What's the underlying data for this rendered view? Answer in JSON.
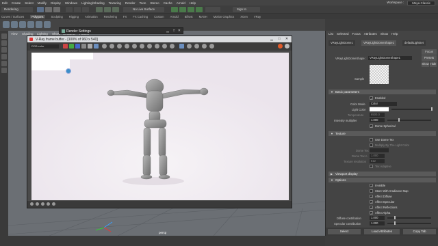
{
  "menubar": {
    "items": [
      "Edit",
      "Create",
      "Select",
      "Modify",
      "Display",
      "Windows",
      "Lighting/Shading",
      "Texturing",
      "Render",
      "Toon",
      "Stereo",
      "Cache",
      "Arnold",
      "Help"
    ],
    "workspace_label": "Workspace :",
    "workspace_value": "Maya Classic"
  },
  "statusline": {
    "mode": "Rendering",
    "symmetry": "No Live Surface",
    "sign_in": "Sign In"
  },
  "shelf": {
    "tabs": [
      "Curves / Surfaces",
      "Polygons",
      "Sculpting",
      "Rigging",
      "Animation",
      "Rendering",
      "FX",
      "FX Caching",
      "Custom",
      "Arnold",
      "Bifrost",
      "MASH",
      "Motion Graphics",
      "XGen",
      "VRay"
    ],
    "active_tab": "Polygons"
  },
  "viewport": {
    "menu": [
      "View",
      "Shading",
      "Lighting",
      "Show",
      "Renderer",
      "Panels"
    ],
    "camera_label": "persp"
  },
  "render_settings_window": {
    "title": "Render Settings"
  },
  "frame_buffer": {
    "title": "V-Ray frame buffer - [100% of 960 x 540]",
    "channel": "RGB color"
  },
  "attribute_editor": {
    "menu": [
      "List",
      "Selected",
      "Focus",
      "Attributes",
      "Show",
      "Help"
    ],
    "node_tabs": [
      "VRayLightDome1",
      "VRayLightDomeShape1",
      "defaultLightSet"
    ],
    "node_type_label": "VRayLightDomeShape:",
    "node_name": "VRayLightDomeShape1",
    "side_buttons": [
      "Focus",
      "Presets",
      "Show",
      "Hide"
    ],
    "sample_label": "Sample",
    "sections": {
      "basic": "Basic parameters",
      "texture": "Texture",
      "viewport": "Viewport display",
      "options": "Options"
    },
    "basic": {
      "enabled": "Enabled",
      "color_mode_label": "Color Mode",
      "color_mode_value": "Color",
      "light_color_label": "Light Color",
      "temperature_label": "Temperature",
      "temperature_value": "6500.0",
      "intensity_label": "Intensity multiplier",
      "intensity_value": "1.000",
      "dome_spherical": "Dome Spherical",
      "light_color": "#ffffff",
      "intensity_fraction": 0.25
    },
    "texture": {
      "use_dome_tex": "Use Dome Tex",
      "multiply_by_light_color": "Multiply By The Light Color",
      "dome_tex_label": "Dome Tex",
      "dome_tex_a_label": "Dome Tex A",
      "dome_tex_a_value": "1.000",
      "resolution_label": "Texture resolution",
      "resolution_value": "512",
      "tex_adaptive": "Tex Adaptive"
    },
    "options": {
      "invisible": "Invisible",
      "store_irradiance": "Store With Irradiance Map",
      "affect_diffuse": "Affect Diffuse",
      "affect_specular": "Affect Specular",
      "affect_reflections": "Affect Reflections",
      "affect_alpha": "Affect Alpha",
      "diffuse_contribution_label": "Diffuse contribution",
      "diffuse_contribution_value": "1.000",
      "specular_contribution_label": "Specular contribution",
      "specular_contribution_value": "1.000"
    },
    "buttons": [
      "Select",
      "Load Attributes",
      "Copy Tab"
    ]
  }
}
